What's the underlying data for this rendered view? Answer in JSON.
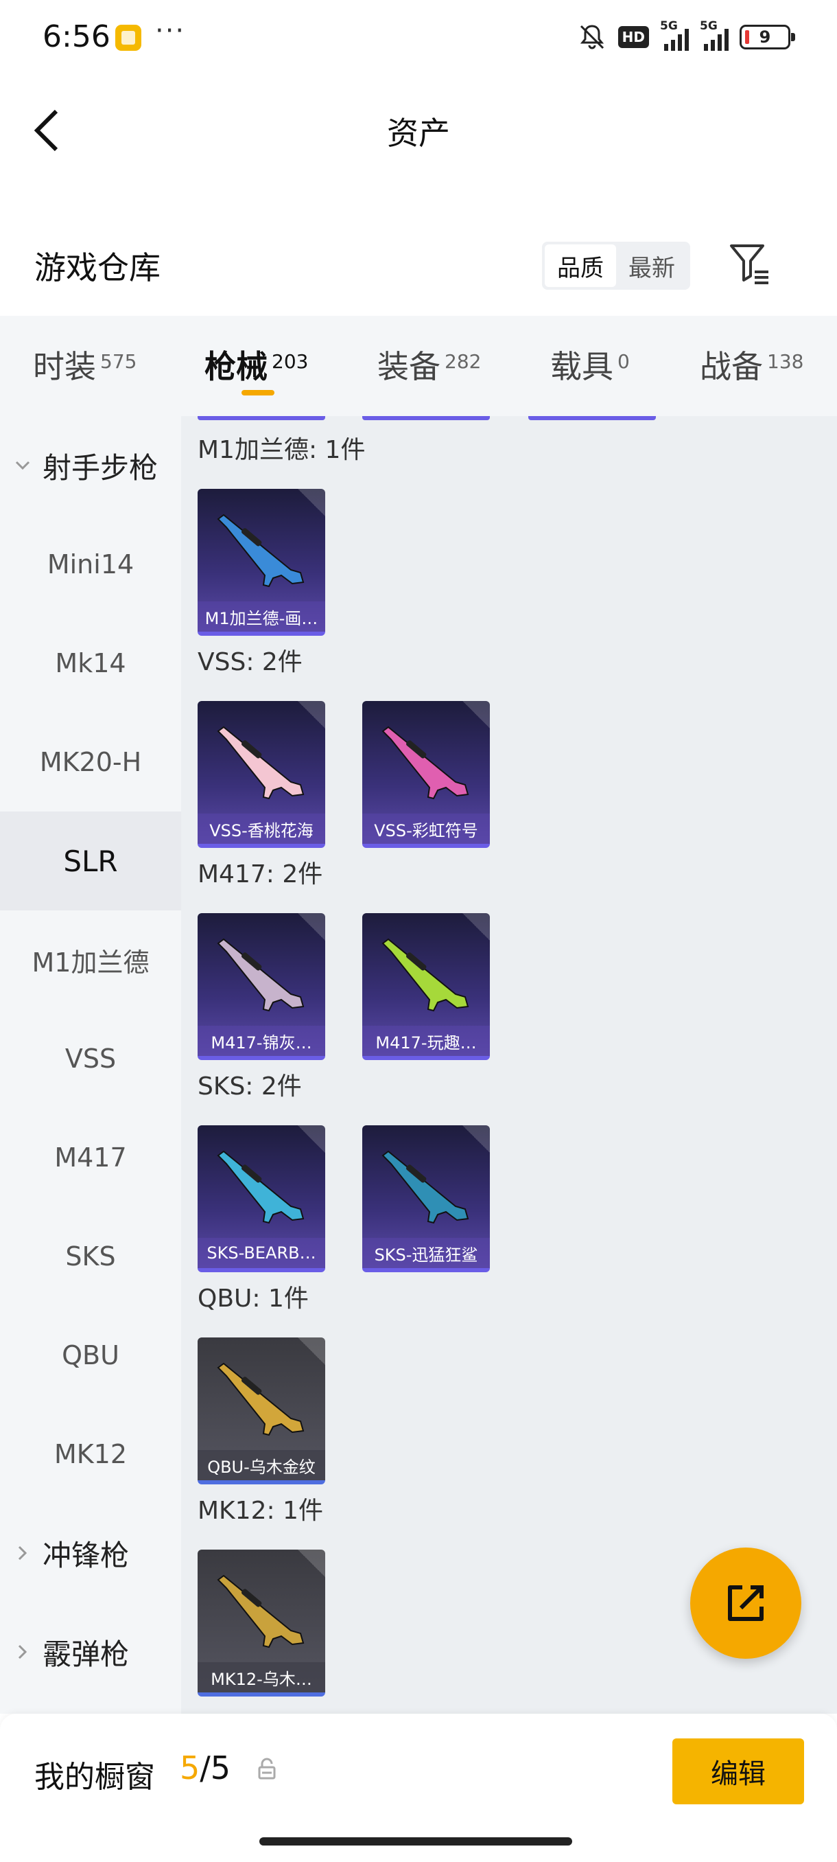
{
  "status_bar": {
    "time": "6:56",
    "dots": "···",
    "hd": "HD",
    "signal1": "5G",
    "signal2": "5G",
    "battery": "9"
  },
  "header": {
    "title": "资产"
  },
  "section": {
    "title": "游戏仓库",
    "sort_options": [
      "品质",
      "最新"
    ],
    "active_sort": "品质"
  },
  "tabs": [
    {
      "label": "时装",
      "count": "575"
    },
    {
      "label": "枪械",
      "count": "203",
      "active": true
    },
    {
      "label": "装备",
      "count": "282"
    },
    {
      "label": "载具",
      "count": "0"
    },
    {
      "label": "战备",
      "count": "138"
    }
  ],
  "sidebar": {
    "group_open": "射手步枪",
    "items": [
      "Mini14",
      "Mk14",
      "MK20-H",
      "SLR",
      "M1加兰德",
      "VSS",
      "M417",
      "SKS",
      "QBU",
      "MK12"
    ],
    "active_item": "SLR",
    "group_collapsed_1": "冲锋枪",
    "group_collapsed_2": "霰弹枪"
  },
  "groups": [
    {
      "label": "M1加兰德: 1件",
      "cards": [
        {
          "name": "M1加兰德-画…",
          "style": "purple",
          "accent": "#3a8bd8"
        }
      ]
    },
    {
      "label": "VSS: 2件",
      "cards": [
        {
          "name": "VSS-香桃花海",
          "style": "purple",
          "accent": "#f4c6d2"
        },
        {
          "name": "VSS-彩虹符号",
          "style": "purple",
          "accent": "#e05fb0"
        }
      ]
    },
    {
      "label": "M417: 2件",
      "cards": [
        {
          "name": "M417-锦灰…",
          "style": "purple",
          "accent": "#c7b3cc"
        },
        {
          "name": "M417-玩趣…",
          "style": "purple",
          "accent": "#a6d93a"
        }
      ]
    },
    {
      "label": "SKS: 2件",
      "cards": [
        {
          "name": "SKS-BEARB…",
          "style": "purple",
          "accent": "#3fb3d8"
        },
        {
          "name": "SKS-迅猛狂鲨",
          "style": "purple",
          "accent": "#2f8fb5"
        }
      ]
    },
    {
      "label": "QBU: 1件",
      "cards": [
        {
          "name": "QBU-乌木金纹",
          "style": "grey",
          "accent": "#d2a63a"
        }
      ]
    },
    {
      "label": "MK12: 1件",
      "cards": [
        {
          "name": "MK12-乌木…",
          "style": "grey",
          "accent": "#c9a23c"
        }
      ]
    }
  ],
  "bottom": {
    "showcase_label": "我的橱窗",
    "current": "5",
    "total": "5",
    "edit_label": "编辑"
  },
  "colors": {
    "accent": "#f5a800",
    "card_border": "#6a5de6"
  }
}
